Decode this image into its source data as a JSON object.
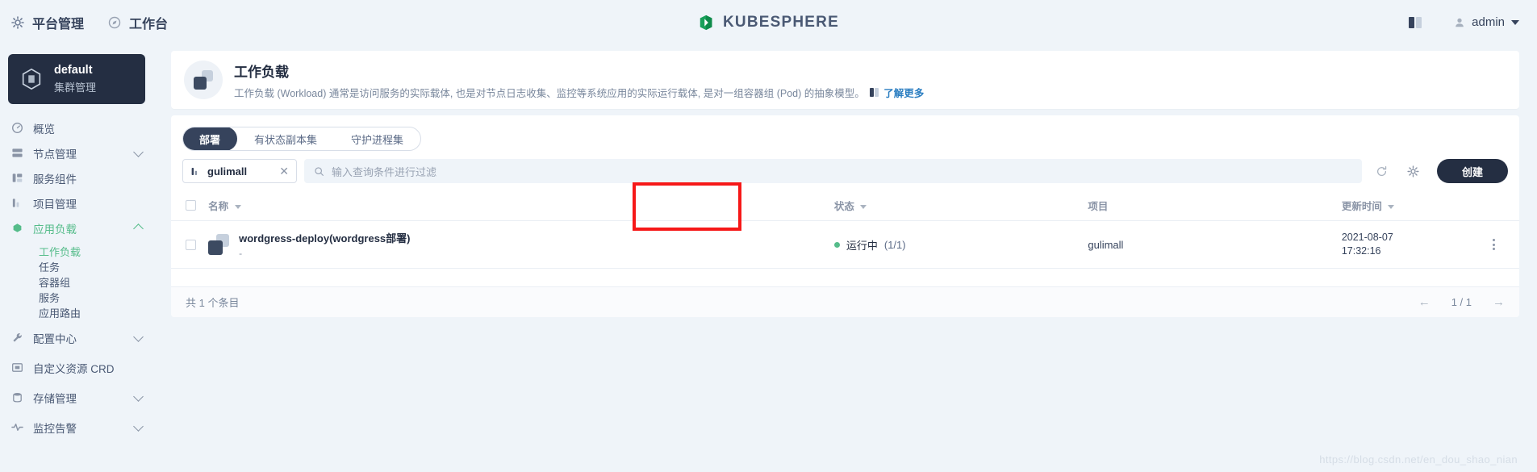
{
  "topbar": {
    "left_items": [
      {
        "label": "平台管理",
        "icon": "gear-icon"
      },
      {
        "label": "工作台",
        "icon": "compass-icon"
      }
    ],
    "logo_text": "KUBESPHERE",
    "logo_color": "#18a05a",
    "apps_icon": "apps-grid-icon",
    "user": {
      "name": "admin",
      "avatar_icon": "user-icon",
      "caret_icon": "caret-down-icon"
    }
  },
  "sidebar": {
    "cluster": {
      "name": "default",
      "subtitle": "集群管理",
      "icon": "cube-icon"
    },
    "items": [
      {
        "label": "概览",
        "icon": "dashboard-icon",
        "expandable": false,
        "active": false
      },
      {
        "label": "节点管理",
        "icon": "nodes-icon",
        "expandable": true,
        "expanded": false,
        "active": false
      },
      {
        "label": "服务组件",
        "icon": "components-icon",
        "expandable": false,
        "active": false
      },
      {
        "label": "项目管理",
        "icon": "project-icon",
        "expandable": false,
        "active": false
      },
      {
        "label": "应用负载",
        "icon": "workload-icon",
        "expandable": true,
        "expanded": true,
        "active": true,
        "children": [
          {
            "label": "工作负载",
            "active": true
          },
          {
            "label": "任务",
            "active": false
          },
          {
            "label": "容器组",
            "active": false
          },
          {
            "label": "服务",
            "active": false
          },
          {
            "label": "应用路由",
            "active": false
          }
        ]
      },
      {
        "label": "配置中心",
        "icon": "wrench-icon",
        "expandable": true,
        "expanded": false,
        "active": false
      },
      {
        "label": "自定义资源 CRD",
        "icon": "crd-icon",
        "expandable": false,
        "active": false
      },
      {
        "label": "存储管理",
        "icon": "storage-icon",
        "expandable": true,
        "expanded": false,
        "active": false
      },
      {
        "label": "监控告警",
        "icon": "monitor-icon",
        "expandable": true,
        "expanded": false,
        "active": false
      }
    ]
  },
  "banner": {
    "icon": "workload-banner-icon",
    "title": "工作负载",
    "description": "工作负载 (Workload) 通常是访问服务的实际载体, 也是对节点日志收集、监控等系统应用的实际运行载体, 是对一组容器组 (Pod) 的抽象模型。",
    "learn_more": "了解更多",
    "learn_more_icon": "doc-icon"
  },
  "tabs": [
    {
      "label": "部署",
      "active": true
    },
    {
      "label": "有状态副本集",
      "active": false
    },
    {
      "label": "守护进程集",
      "active": false
    }
  ],
  "toolbar": {
    "project_chip": {
      "label": "gulimall",
      "icon": "project-icon",
      "clear_icon": "close-icon"
    },
    "search": {
      "placeholder": "输入查询条件进行过滤",
      "value": "",
      "icon": "search-icon"
    },
    "refresh_icon": "refresh-icon",
    "settings_icon": "gear-icon",
    "create_label": "创建"
  },
  "table": {
    "select_all_checked": false,
    "columns": [
      {
        "key": "name",
        "label": "名称",
        "sortable": true
      },
      {
        "key": "status",
        "label": "状态",
        "sortable": true
      },
      {
        "key": "project",
        "label": "项目",
        "sortable": false
      },
      {
        "key": "updated",
        "label": "更新时间",
        "sortable": true
      }
    ],
    "rows": [
      {
        "checked": false,
        "icon": "deployment-icon",
        "name": "wordgress-deploy(wordgress部署)",
        "subtitle": "-",
        "status_text": "运行中",
        "status_count": "(1/1)",
        "status_color": "#55bc8a",
        "project": "gulimall",
        "updated": "2021-08-07 17:32:16",
        "more_icon": "kebab-menu-icon"
      }
    ]
  },
  "footer": {
    "total": "共 1 个条目",
    "prev_icon": "arrow-left-icon",
    "page_indicator": "1 / 1",
    "next_icon": "arrow-right-icon"
  },
  "annotation": {
    "highlight_color": "#f61818"
  },
  "watermark": "https://blog.csdn.net/en_dou_shao_nian"
}
